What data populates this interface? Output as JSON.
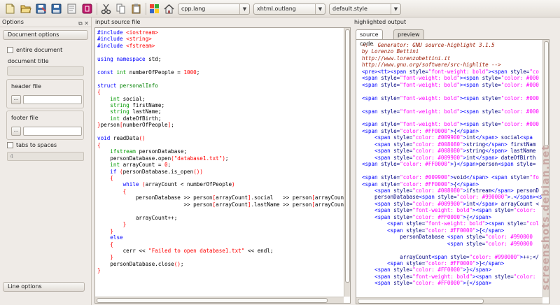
{
  "toolbar": {
    "icons": [
      "new-icon",
      "open-icon",
      "save-as-icon",
      "save-icon",
      "close-icon",
      "quit-icon",
      "cut-icon",
      "copy-icon",
      "paste-icon",
      "palette-icon",
      "home-icon"
    ],
    "combos": [
      {
        "name": "input-language-select",
        "value": "cpp.lang"
      },
      {
        "name": "output-format-select",
        "value": "xhtml.outlang"
      },
      {
        "name": "style-select",
        "value": "default.style"
      }
    ]
  },
  "left": {
    "title": "Options",
    "document_options": "Document options",
    "entire_document": "entire document",
    "document_title": "document title",
    "header_file": "header file",
    "footer_file": "footer file",
    "browse": "...",
    "tabs_to_spaces": "tabs to spaces",
    "tab_value": "4",
    "line_options": "Line options"
  },
  "input": {
    "title": "input source file",
    "lines": [
      "#include <iostream>",
      "#include <string>",
      "#include <fstream>",
      "",
      "using namespace std;",
      "",
      "const int numberOfPeople = 1000;",
      "",
      "struct personalInfo",
      "{",
      "    int social;",
      "    string firstName;",
      "    string lastName;",
      "    int dateOfBirth;",
      "}person[numberOfPeople];",
      "",
      "void readData()",
      "{",
      "    ifstream personDatabase;",
      "    personDatabase.open(\"database1.txt\");",
      "    int arrayCount = 0;",
      "    if (personDatabase.is_open())",
      "    {",
      "        while (arrayCount < numberOfPeople)",
      "        {",
      "            personDatabase >> person[arrayCount].social   >> person[arrayCount",
      "                           >> person[arrayCount].lastName >> person[arrayCount",
      "",
      "            arrayCount++;",
      "        }",
      "    }",
      "    else",
      "    {",
      "        cerr << \"Failed to open database1.txt\" << endl;",
      "    }",
      "    personDatabase.close();",
      "}"
    ]
  },
  "output": {
    "title": "highlighted output",
    "tab_source": "source code",
    "tab_preview": "preview",
    "lines": [
      "<!-- Generator: GNU source-highlight 3.1.5",
      "by Lorenzo Bettini",
      "http://www.lorenzobettini.it",
      "http://www.gnu.org/software/src-highlite -->",
      "<pre><tt><span style=\"font-weight: bold\"><span style=\"co",
      "<span style=\"font-weight: bold\"><span style=\"color: #000",
      "<span style=\"font-weight: bold\"><span style=\"color: #000",
      "",
      "<span style=\"font-weight: bold\"><span style=\"color: #000",
      "",
      "<span style=\"font-weight: bold\"><span style=\"color: #000",
      "",
      "<span style=\"font-weight: bold\"><span style=\"color: #000",
      "<span style=\"color: #FF0000\">{</span>",
      "    <span style=\"color: #009900\">int</span> social<spa",
      "    <span style=\"color: #008080\">string</span> firstNam",
      "    <span style=\"color: #008080\">string</span> lastName",
      "    <span style=\"color: #009900\">int</span> dateOfBirth",
      "<span style=\"color: #FF0000\">}</span>person<span style=",
      "",
      "<span style=\"color: #009900\">void</span> <span style=\"fo",
      "<span style=\"color: #FF0000\">{</span>",
      "    <span style=\"color: #008080\">ifstream</span> personD",
      "    personDatabase<span style=\"color: #990000\">.</span><sp",
      "    <span style=\"color: #009900\">int</span> arrayCount <",
      "    <span style=\"font-weight: bold\"><span style=\"color:",
      "    <span style=\"color: #FF0000\">{</span>",
      "        <span style=\"font-weight: bold\"><span style=\"col",
      "        <span style=\"color: #FF0000\">{</span>",
      "            personDatabase <span style=\"color: #990000",
      "                           <span style=\"color: #990000",
      "",
      "            arrayCount<span style=\"color: #990000\">++;</",
      "        <span style=\"color: #FF0000\">}</span>",
      "    <span style=\"color: #FF0000\">}</span>",
      "    <span style=\"font-weight: bold\"><span style=\"color:",
      "    <span style=\"color: #FF0000\">{</span>"
    ]
  },
  "watermark": "screenshots.debian.net"
}
